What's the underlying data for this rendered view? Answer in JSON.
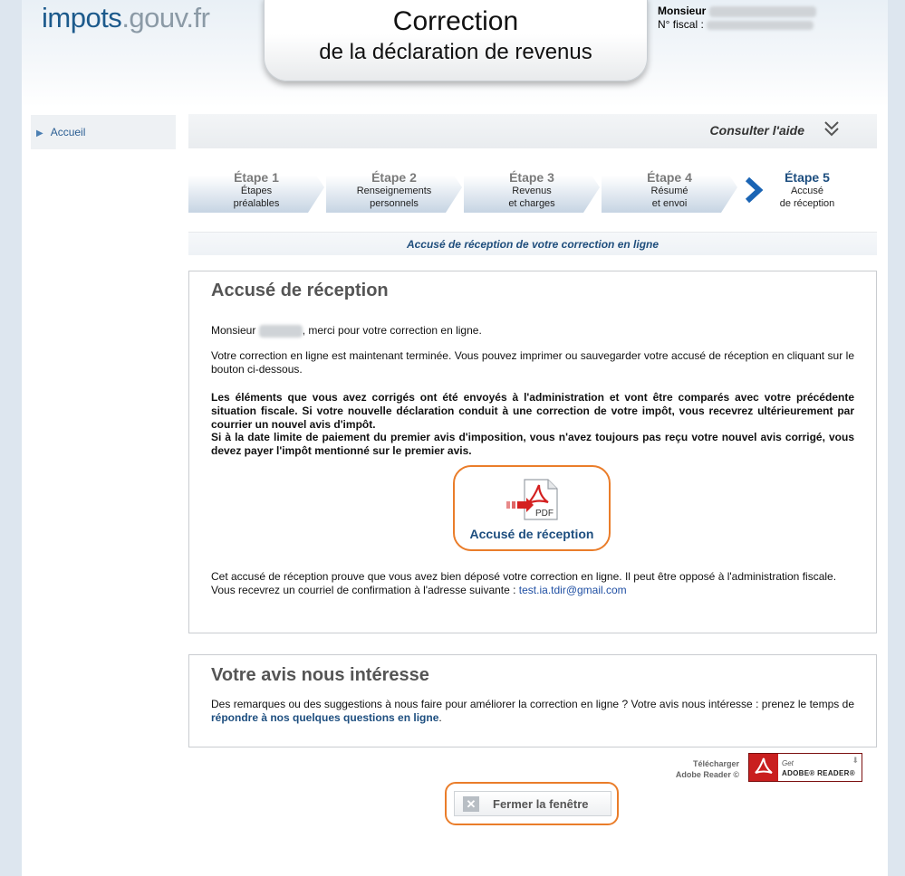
{
  "header": {
    "logo_main": "impots",
    "logo_domain": ".gouv.fr",
    "title_line1": "Correction",
    "title_line2": "de la déclaration de revenus",
    "user_label": "Monsieur",
    "fiscal_label": "N° fiscal :"
  },
  "nav": {
    "home_label": "Accueil"
  },
  "help": {
    "label": "Consulter l'aide"
  },
  "steps": [
    {
      "title": "Étape 1",
      "line1": "Étapes",
      "line2": "préalables"
    },
    {
      "title": "Étape 2",
      "line1": "Renseignements",
      "line2": "personnels"
    },
    {
      "title": "Étape 3",
      "line1": "Revenus",
      "line2": "et charges"
    },
    {
      "title": "Étape 4",
      "line1": "Résumé",
      "line2": "et envoi"
    },
    {
      "title": "Étape 5",
      "line1": "Accusé",
      "line2": "de réception"
    }
  ],
  "sub_title": "Accusé de réception de votre correction en ligne",
  "receipt": {
    "title": "Accusé de réception",
    "greeting_prefix": "Monsieur",
    "greeting_suffix": ", merci pour votre correction en ligne.",
    "p2": "Votre correction en ligne est maintenant terminée. Vous pouvez imprimer ou sauvegarder votre accusé de réception en cliquant sur le bouton ci-dessous.",
    "p3": "Les éléments que vous avez corrigés ont été envoyés à l'administration et vont être comparés avec votre précédente situation fiscale. Si votre nouvelle déclaration conduit à une correction de votre impôt, vous recevrez ultérieurement par courrier un nouvel avis d'impôt.",
    "p4": "Si à la date limite de paiement du premier avis d'imposition, vous n'avez toujours pas reçu votre nouvel avis corrigé, vous devez payer l'impôt mentionné sur le premier avis.",
    "pdf_badge": "PDF",
    "pdf_button_label": "Accusé de réception",
    "p5": "Cet accusé de réception prouve que vous avez bien déposé votre correction en ligne. Il peut être opposé à l'administration fiscale.",
    "p6_prefix": "Vous recevrez un courriel de confirmation à l'adresse suivante : ",
    "email": "test.ia.tdir@gmail.com"
  },
  "opinion": {
    "title": "Votre avis nous intéresse",
    "text_prefix": "Des remarques ou des suggestions à nous faire pour améliorer la correction en ligne ? Votre avis nous intéresse : prenez le temps de ",
    "link": "répondre à nos quelques questions en ligne",
    "text_suffix": "."
  },
  "adobe": {
    "download_line1": "Télécharger",
    "download_line2": "Adobe Reader ©",
    "badge_get": "Get",
    "badge_name": "ADOBE® READER®"
  },
  "close_button": {
    "label": "Fermer la fenêtre"
  },
  "colors": {
    "accent_orange": "#ea7d2a",
    "link_blue": "#1d4e7f",
    "active_step_arrow": "#1a64b4"
  }
}
